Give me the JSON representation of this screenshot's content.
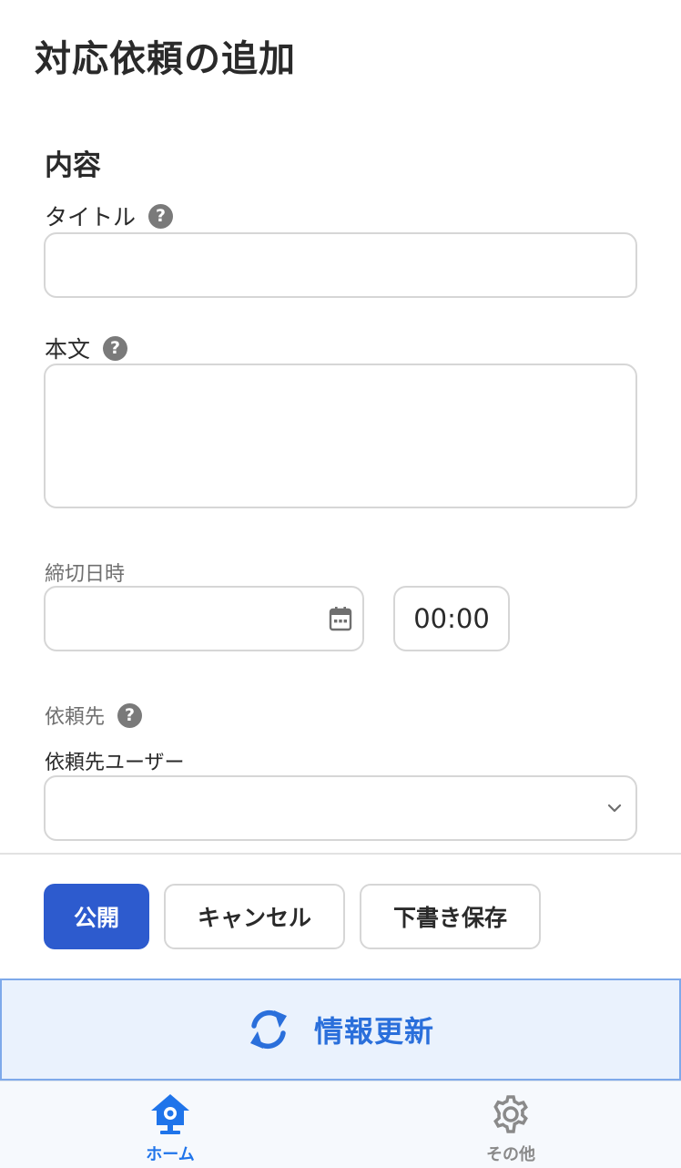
{
  "header": {
    "title": "対応依頼の追加"
  },
  "content_section": {
    "heading": "内容",
    "title_field": {
      "label": "タイトル",
      "help": "?",
      "value": "",
      "placeholder": ""
    },
    "body_field": {
      "label": "本文",
      "help": "?",
      "value": "",
      "placeholder": ""
    },
    "deadline": {
      "label": "締切日時",
      "date_value": "",
      "time_value": "00:00"
    },
    "assignee": {
      "label": "依頼先",
      "help": "?",
      "user_label": "依頼先ユーザー",
      "selected": ""
    }
  },
  "actions": {
    "publish": "公開",
    "cancel": "キャンセル",
    "save_draft": "下書き保存"
  },
  "refresh": {
    "label": "情報更新"
  },
  "tabbar": {
    "items": [
      {
        "label": "ホーム",
        "icon": "home-icon",
        "active": true
      },
      {
        "label": "その他",
        "icon": "gear-icon",
        "active": false
      }
    ]
  },
  "colors": {
    "primary": "#2d5bce",
    "accent": "#1f74ea",
    "refresh_bg": "#eaf2fd"
  }
}
